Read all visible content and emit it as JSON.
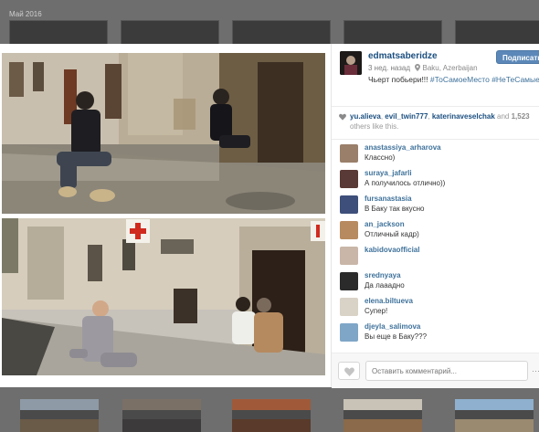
{
  "background": {
    "date_label": "Май 2016"
  },
  "post": {
    "username": "edmatsaberidze",
    "time_ago": "3 нед. назад",
    "location": "Baku, Azerbaijan",
    "caption_text": "Чьерт побьери!!! ",
    "hashtags": "#ТоСамоеМесто #НеТеСамыеЛюди",
    "follow_label": "Подписаться",
    "likers": [
      "yu.alieva",
      "evil_twin777",
      "katerinaveselchak"
    ],
    "likes_sep1": ", ",
    "likes_sep2": " and ",
    "likes_count": "1,523",
    "likes_suffix": "others like this."
  },
  "comments": [
    {
      "user": "anastassiya_arharova",
      "text": "Классно)"
    },
    {
      "user": "suraya_jafarli",
      "text": "А получилось отлично))"
    },
    {
      "user": "fursanastasia",
      "text": "В Баку так вкусно"
    },
    {
      "user": "an_jackson",
      "text": "Отличный кадр)"
    },
    {
      "user": "kabidovaofficial",
      "text": ""
    },
    {
      "user": "srednyaya",
      "text": "Да лааадно"
    },
    {
      "user": "elena.biltueva",
      "text": "Супер!"
    },
    {
      "user": "djeyla_salimova",
      "text": "Вы еще в Баку???"
    }
  ],
  "comment_box": {
    "placeholder": "Оставить комментарий..."
  },
  "icons": {
    "heart": "heart-icon",
    "location": "location-pin-icon",
    "more": "ellipsis-icon"
  },
  "colors": {
    "link": "#3f729b",
    "username": "#1b4f80",
    "follow_button": "#5b88b8"
  }
}
